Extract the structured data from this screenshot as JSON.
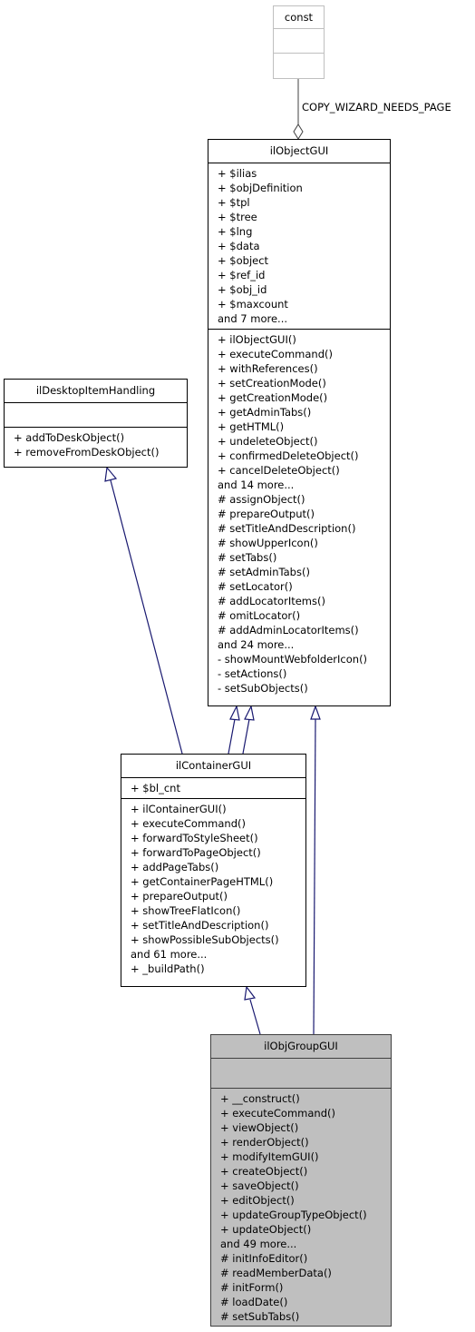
{
  "diagram": {
    "type": "uml-class-inheritance",
    "classes": {
      "const": {
        "name": "const",
        "attributes": [],
        "methods": []
      },
      "ilObjectGUI": {
        "name": "ilObjectGUI",
        "attributes": [
          "+ $ilias",
          "+ $objDefinition",
          "+ $tpl",
          "+ $tree",
          "+ $lng",
          "+ $data",
          "+ $object",
          "+ $ref_id",
          "+ $obj_id",
          "+ $maxcount",
          "and 7 more..."
        ],
        "methods": [
          "+ ilObjectGUI()",
          "+ executeCommand()",
          "+ withReferences()",
          "+ setCreationMode()",
          "+ getCreationMode()",
          "+ getAdminTabs()",
          "+ getHTML()",
          "+ undeleteObject()",
          "+ confirmedDeleteObject()",
          "+ cancelDeleteObject()",
          "and 14 more...",
          "# assignObject()",
          "# prepareOutput()",
          "# setTitleAndDescription()",
          "# showUpperIcon()",
          "# setTabs()",
          "# setAdminTabs()",
          "# setLocator()",
          "# addLocatorItems()",
          "# omitLocator()",
          "# addAdminLocatorItems()",
          "and 24 more...",
          "- showMountWebfolderIcon()",
          "- setActions()",
          "- setSubObjects()"
        ]
      },
      "ilDesktopItemHandling": {
        "name": "ilDesktopItemHandling",
        "attributes": [],
        "methods": [
          "+ addToDeskObject()",
          "+ removeFromDeskObject()"
        ]
      },
      "ilContainerGUI": {
        "name": "ilContainerGUI",
        "attributes": [
          "+ $bl_cnt"
        ],
        "methods": [
          "+ ilContainerGUI()",
          "+ executeCommand()",
          "+ forwardToStyleSheet()",
          "+ forwardToPageObject()",
          "+ addPageTabs()",
          "+ getContainerPageHTML()",
          "+ prepareOutput()",
          "+ showTreeFlatIcon()",
          "+ setTitleAndDescription()",
          "+ showPossibleSubObjects()",
          "and 61 more...",
          "+ _buildPath()"
        ]
      },
      "ilObjGroupGUI": {
        "name": "ilObjGroupGUI",
        "attributes": [],
        "methods": [
          "+ __construct()",
          "+ executeCommand()",
          "+ viewObject()",
          "+ renderObject()",
          "+ modifyItemGUI()",
          "+ createObject()",
          "+ saveObject()",
          "+ editObject()",
          "+ updateGroupTypeObject()",
          "+ updateObject()",
          "and 49 more...",
          "# initInfoEditor()",
          "# readMemberData()",
          "# initForm()",
          "# loadDate()",
          "# setSubTabs()"
        ]
      }
    },
    "relations": [
      {
        "from": "const",
        "to": "ilObjectGUI",
        "kind": "aggregation",
        "label": "COPY_WIZARD_NEEDS_PAGE"
      },
      {
        "from": "ilContainerGUI",
        "to": "ilDesktopItemHandling",
        "kind": "inheritance"
      },
      {
        "from": "ilContainerGUI",
        "to": "ilObjectGUI",
        "kind": "inheritance"
      },
      {
        "from": "ilContainerGUI",
        "to": "ilObjectGUI",
        "kind": "inheritance"
      },
      {
        "from": "ilObjGroupGUI",
        "to": "ilContainerGUI",
        "kind": "inheritance"
      },
      {
        "from": "ilObjGroupGUI",
        "to": "ilObjectGUI",
        "kind": "inheritance"
      }
    ],
    "colors": {
      "edge_inheritance": "#191970",
      "edge_aggregation": "#404040",
      "focus_fill": "#bfbfbf",
      "external_border": "#bfbfbf"
    }
  }
}
